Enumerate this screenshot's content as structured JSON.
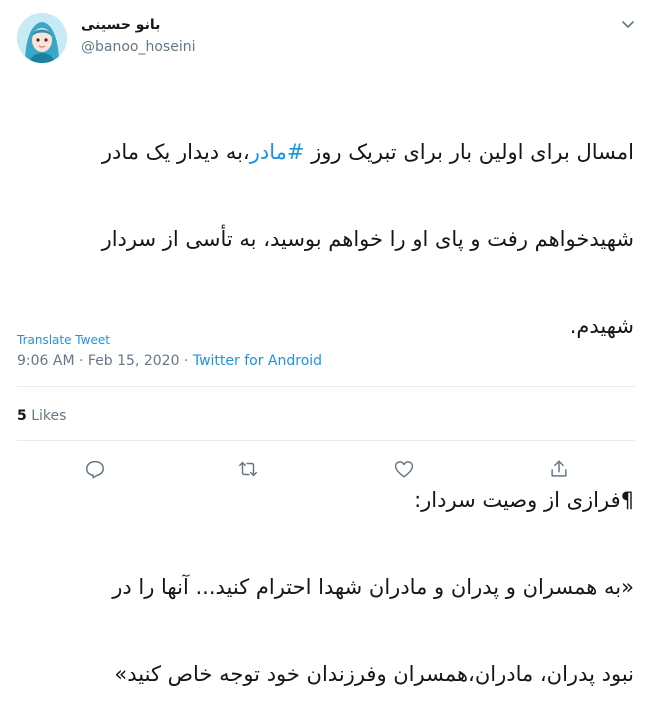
{
  "author": {
    "display_name": "بانو حسینی",
    "handle": "@banoo_hoseini"
  },
  "tweet": {
    "line1_pre": "امسال برای اولین بار برای تبریک روز ",
    "line1_hashtag": "#مادر",
    "line1_post": "،به دیدار یک مادر",
    "line2": "شهیدخواهم رفت و پای او را خواهم بوسید، به تأسی از سردار",
    "line3": "شهیدم.",
    "line4": "",
    "line5": "¶فرازی از وصیت سردار:",
    "line6": "«به همسران و پدران و مادران شهدا احترام کنید... آنها را در",
    "line7": "نبود پدران، مادران،همسران وفرزندان خود توجه خاص کنید»"
  },
  "translate_label": "Translate Tweet",
  "meta": {
    "time": "9:06 AM",
    "separator": " · ",
    "date": "Feb 15, 2020",
    "client": "Twitter for Android"
  },
  "likes": {
    "count": "5",
    "label": " Likes"
  },
  "icons": {
    "reply": "reply-icon",
    "retweet": "retweet-icon",
    "like": "heart-icon",
    "share": "share-icon",
    "menu": "chevron-down-icon"
  },
  "colors": {
    "link": "#1b95e0",
    "secondary": "#657786",
    "divider": "#e6ecf0"
  }
}
